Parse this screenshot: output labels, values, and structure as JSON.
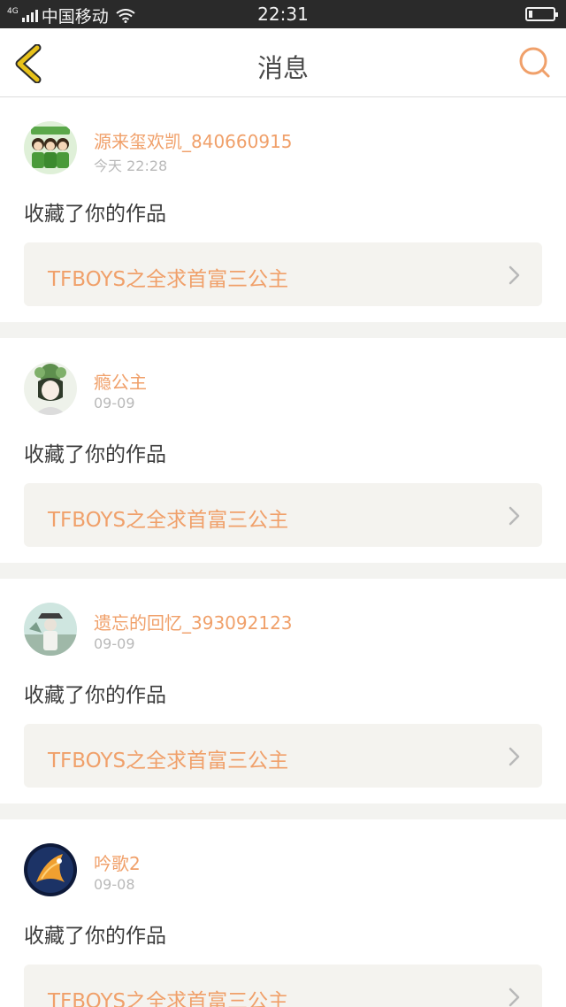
{
  "status_bar": {
    "network": "4G",
    "carrier": "中国移动",
    "time": "22:31"
  },
  "header": {
    "title": "消息",
    "back_icon": "chevron-left-icon",
    "search_icon": "search-icon"
  },
  "colors": {
    "accent": "#f0a06a",
    "back_icon": "#e8c21a",
    "background": "#f3f3f0",
    "card": "#f4f3ef"
  },
  "messages": [
    {
      "username": "源来玺欢凯_840660915",
      "time": "今天 22:28",
      "action": "收藏了你的作品",
      "work_title": "TFBOYS之全求首富三公主"
    },
    {
      "username": "瘾公主",
      "time": "09-09",
      "action": "收藏了你的作品",
      "work_title": "TFBOYS之全求首富三公主"
    },
    {
      "username": "遗忘的回忆_393092123",
      "time": "09-09",
      "action": "收藏了你的作品",
      "work_title": "TFBOYS之全求首富三公主"
    },
    {
      "username": "吟歌2",
      "time": "09-08",
      "action": "收藏了你的作品",
      "work_title": "TFBOYS之全求首富三公主"
    }
  ]
}
